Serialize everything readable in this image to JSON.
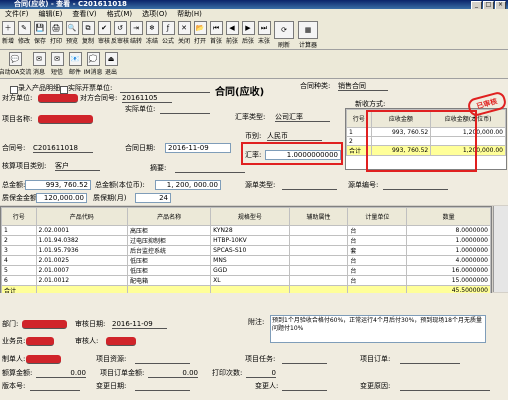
{
  "window": {
    "title": "合同(应收) - 查看 - C201611018"
  },
  "menu": [
    "文件(F)",
    "编辑(E)",
    "查看(V)",
    "格式(M)",
    "选项(O)",
    "帮助(H)"
  ],
  "toolbar": [
    "新增",
    "修改",
    "保存",
    "打印",
    "预览",
    "复制",
    "审核",
    "反审核",
    "结转",
    "冻结",
    "公式",
    "关闭",
    "打开",
    "首张",
    "前张",
    "后张",
    "末张",
    "刷新",
    "计算器"
  ],
  "toolbar2": [
    "启动OA交流",
    "消息",
    "短信",
    "邮件",
    "IM消息",
    "退出"
  ],
  "form": {
    "record_inv": "录入产品明细",
    "actual_unit": "实际开票单位:",
    "other_unit": "对方单位:",
    "other_contract": "对方合同号:",
    "other_contract_val": "20161105",
    "actual_unit2": "实际单位:",
    "contract_type_lbl": "合同种类:",
    "contract_type": "销售合同",
    "title": "合同(应收)",
    "project_name": "项目名称:",
    "rate_type_lbl": "汇率类型:",
    "rate_type": "公司汇率",
    "currency_lbl": "币别:",
    "currency": "人民币",
    "contract_no_lbl": "合同号:",
    "contract_no": "C201611018",
    "contract_date_lbl": "合同日期:",
    "contract_date": "2016-11-09",
    "rate_lbl": "汇率:",
    "rate": "1.0000000000",
    "core_class": "核算项目类别:",
    "core_class_val": "客户",
    "summary": "摘要:",
    "total_lbl": "总金额:",
    "total": "993, 760.52",
    "total_base_lbl": "总金额(本位币):",
    "total_base": "1, 200, 000.00",
    "source_type": "源单类型:",
    "source_no": "源单编号:",
    "warranty_lbl": "质保金金额:",
    "warranty": "120,000.00",
    "warranty_months_lbl": "质保期(月)",
    "warranty_months": "24",
    "pay_method": "新收方式:",
    "stamp": "已审核"
  },
  "pay_table": {
    "headers": [
      "行号",
      "应收金额",
      "应收金额(本位币)"
    ],
    "rows": [
      [
        "1",
        "993, 760.52",
        "1,200,000.00"
      ],
      [
        "2",
        "",
        ""
      ]
    ],
    "total": [
      "合计",
      "993, 760.52",
      "1,200,000.00"
    ]
  },
  "grid": {
    "headers": [
      "行号",
      "产品代码",
      "产品名称",
      "规格型号",
      "辅助属性",
      "计量单位",
      "数量"
    ],
    "rows": [
      [
        "1",
        "2.02.0001",
        "高压柜",
        "KYN28",
        "",
        "台",
        "8.0000000"
      ],
      [
        "2",
        "1.01.94.0382",
        "过电压抑制柜",
        "HTBP-10KV",
        "",
        "台",
        "1.0000000"
      ],
      [
        "3",
        "1.01.95.7936",
        "后台监控系统",
        "SPCAS-S10",
        "",
        "套",
        "1.0000000"
      ],
      [
        "4",
        "2.01.0025",
        "低压柜",
        "MNS",
        "",
        "台",
        "4.0000000"
      ],
      [
        "5",
        "2.01.0007",
        "低压柜",
        "GGD",
        "",
        "台",
        "16.0000000"
      ],
      [
        "6",
        "2.01.0012",
        "配电箱",
        "XL",
        "",
        "台",
        "15.0000000"
      ]
    ],
    "total": "45.5000000",
    "total_label": "合计"
  },
  "footer": {
    "dept": "部门:",
    "audit_date_lbl": "审核日期:",
    "audit_date": "2016-11-09",
    "note_lbl": "附注:",
    "note": "预到1个月验收合格付60%，正常运行4个月后付30%，预到现场18个月无质量问题付10%",
    "salesman": "业务员:",
    "auditor": "审核人:",
    "maker": "制单人:",
    "project_resource": "项目资源:",
    "project_task": "项目任务:",
    "project_order": "项目订单:",
    "offset_amount": "额算金额:",
    "offset_val": "0.00",
    "project_total": "项目订单金额:",
    "project_total_val": "0.00",
    "print_count": "打印次数:",
    "print_val": "0",
    "version": "版本号:",
    "change_date": "变更日期:",
    "changer": "变更人:",
    "change_reason": "变更原因:"
  }
}
